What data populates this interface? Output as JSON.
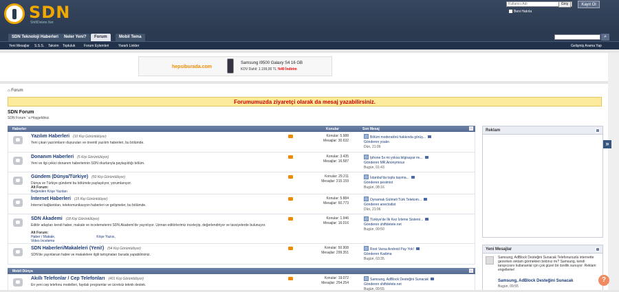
{
  "header": {
    "logo_text": "SDN",
    "logo_sub": "ShiftDelete.Net",
    "username_placeholder": "Kullanıcı Adı",
    "signin_button": "Giriş",
    "login_button": "Kayıt Ol",
    "remember_me": "Beni Hatırla"
  },
  "nav": {
    "tabs": [
      "SDN Teknoloji Haberleri",
      "Neler Yeni?",
      "Forum",
      "Mobil Tema"
    ],
    "sub": [
      "Yeni Mesajlar",
      "S.S.S.",
      "Takvim",
      "Topluluk",
      "Forum Eylemleri",
      "Yararlı Linkler"
    ],
    "advanced_search": "Gelişmiş Arama Yap"
  },
  "ad": {
    "brand": "hepsiburada.com",
    "title": "Samsung I9500 Galaxy S4 16 GB",
    "price_prefix": "KDV Dahil: 1.199,00 TL",
    "discount": "%40 İndirim"
  },
  "breadcrumb": "Forum",
  "notice": "Forumumuzda ziyaretçi olarak da mesaj yazabilirsiniz.",
  "forum_title": "SDN Forum",
  "forum_sub": "SDN Forum ' a Hoşgeldiniz.",
  "table_header": {
    "col1": "Haberler",
    "col2": "Konular",
    "col3": "Son Mesaj"
  },
  "cat2": "Mobil Dünya",
  "forums": [
    {
      "name": "Yazılım Haberleri",
      "views": "(10 Kişi Görüntülüyor)",
      "desc": "Yeni çıkan yazılımların duyuruları ve önemli yazılım haberleri, bu bölümde.",
      "topics": "Konular: 5.988",
      "posts": "Mesajlar: 30.632",
      "last_title": "Bölüm moderatörü hakkında görüş...",
      "last_by": "Gönderen yoakn",
      "last_date": "Dün, 21:09"
    },
    {
      "name": "Donanım Haberleri",
      "views": "(5 Kişi Görüntülüyor)",
      "desc": "Yeni ve ilgi çekici donanım haberlerinin SDN okurlarıyla paylaşıldığı bölüm.",
      "topics": "Konular: 3.435",
      "posts": "Mesajlar: 16.587",
      "last_title": "Iphone 5s mi yoksa bilgisayar mı...",
      "last_by": "Gönderen MR.Anonymous",
      "last_date": "Bugün, 01:43"
    },
    {
      "name": "Gündem (Dünya/Türkiye)",
      "views": "(50 Kişi Görüntülüyor)",
      "desc": "Dünya ve Türkiye gündemi bu bölümde paylaşılıyor, yorumlanıyor.",
      "sub_title": "Alt Forum:",
      "sub": [
        "Beğenilen Köşe Yazıları"
      ],
      "topics": "Konular: 29.211",
      "posts": "Mesajlar: 215.159",
      "last_title": "İstanbul'da toplu taşıma...",
      "last_by": "Gönderen pesimist",
      "last_date": "Bugün, 08:16"
    },
    {
      "name": "İnternet Haberleri",
      "views": "(15 Kişi Görüntülüyor)",
      "desc": "İnternet bağlantıları, telekomunikasyon haberleri ve gelişmeler, bu bölümde.",
      "topics": "Konular: 5.884",
      "posts": "Mesajlar: 60.773",
      "last_title": "Oynamalı Gülmeli Türk Telekom...",
      "last_by": "Gönderen anectodist",
      "last_date": "Dün, 21:06"
    },
    {
      "name": "SDN Akademi",
      "views": "(18 Kişi Görüntülüyor)",
      "desc": "Editör adayları kendi haber, makale ve incelemelerini SDN Akademi'de yayınlıyor. Uzman editörlerimiz inceleyip, değerlendiriyor ve tavsiyelerde bulunuyor.",
      "sub_title": "Alt Forum:",
      "sub": [
        "Haber / Makale,",
        "Köşe Yazısı,",
        "Video İnceleme"
      ],
      "topics": "Konular: 1.946",
      "posts": "Mesajlar: 16.016",
      "last_title": "Türkiye'de İlk Kez İzleme Sistemi...",
      "last_by": "Gönderen shiftdelete.net",
      "last_date": "Bugün, 09:50"
    },
    {
      "name": "SDN Haberleri/Makaleleri (Yeni!)",
      "views": "(54 Kişi Görüntülüyor)",
      "desc": "SDN'de yayınlanan haber ve makalelere ilgili tartışmaları burada yapabilirsiniz.",
      "topics": "Konular: 50.908",
      "posts": "Mesajlar: 299.351",
      "last_title": "Root Varsa Android Pay Yok!",
      "last_by": "Gönderen Kadima",
      "last_date": "Bugün, 03:35"
    },
    {
      "name": "Akıllı Telefonlar / Cep Telefonları",
      "views": "(401 Kişi Görüntülüyor)",
      "desc": "En yeni cep telefonu modelleri, faydalı programlar ve ücretsiz teknik destek.",
      "topics": "Konular: 19.072",
      "posts": "Mesajlar: 254.254",
      "last_title": "Samsung, AdBlock Desteğini Sunacak",
      "last_by": "Gönderen shiftdelete.net",
      "last_date": "Bugün, 09:55"
    }
  ],
  "panels": {
    "reklam": "Reklam",
    "yeni_mesajlar": "Yeni Mesajlar",
    "ym_text": "Samsung, AdBlock Desteğini Sunacak Telefonunuzla internette gezerken reklam görmekten bıktınız mı? Samsung, kendi tarayıcısını kullananlar için çok güzel bir özellik sunuyor: Reklam engelleme!",
    "ym_name": "Samsung, AdBlock Desteğini Sunacak",
    "ym_date": "Bugün, 09:55"
  }
}
